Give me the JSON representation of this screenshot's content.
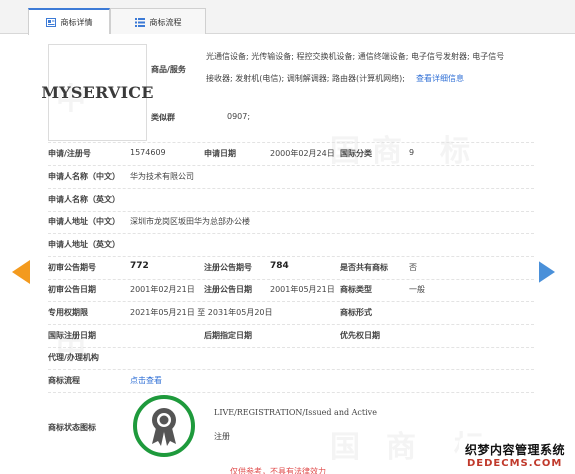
{
  "tabs": [
    {
      "label": "商标详情",
      "active": true
    },
    {
      "label": "商标流程",
      "active": false
    }
  ],
  "watermark_chars": [
    "中",
    "国",
    "商",
    "标"
  ],
  "logo_text": "MYSERVICE",
  "goods_services": {
    "label": "商品/服务",
    "line1": "光通信设备; 光传输设备; 程控交换机设备; 通信终端设备; 电子信号发射器; 电子信号",
    "line2": "接收器; 发射机(电信); 调制解调器; 路由器(计算机网络);",
    "more_link": "查看详细信息"
  },
  "similar_group": {
    "label": "类似群",
    "value": "0907;"
  },
  "fields": {
    "app_no_label": "申请/注册号",
    "app_no": "1574609",
    "app_date_label": "申请日期",
    "app_date": "2000年02月24日",
    "intl_class_label": "国际分类",
    "intl_class": "9",
    "applicant_cn_label": "申请人名称（中文）",
    "applicant_cn": "华为技术有限公司",
    "applicant_en_label": "申请人名称（英文）",
    "address_cn_label": "申请人地址（中文）",
    "address_cn": "深圳市龙岗区坂田华为总部办公楼",
    "address_en_label": "申请人地址（英文）",
    "prelim_issue_label": "初审公告期号",
    "prelim_issue": "772",
    "reg_issue_label": "注册公告期号",
    "reg_issue": "784",
    "shared_label": "是否共有商标",
    "shared": "否",
    "prelim_date_label": "初审公告日期",
    "prelim_date": "2001年02月21日",
    "reg_date_label": "注册公告日期",
    "reg_date": "2001年05月21日",
    "tm_type_label": "商标类型",
    "tm_type": "一般",
    "exclusive_label": "专用权期限",
    "exclusive": "2021年05月21日 至 2031年05月20日",
    "tm_form_label": "商标形式",
    "intl_reg_date_label": "国际注册日期",
    "later_date_label": "后期指定日期",
    "priority_date_label": "优先权日期",
    "agent_label": "代理/办理机构",
    "flow_label": "商标流程",
    "flow_link": "点击查看",
    "status_icon_label": "商标状态图标",
    "status_en": "LIVE/REGISTRATION/Issued and Active",
    "status_cn": "注册"
  },
  "footer_note": "仅供参考，不具有法律效力",
  "corner_badge": {
    "line1": "织梦内容管理系统",
    "line2": "DEDECMS.COM"
  },
  "colors": {
    "accent": "#3c7ad6",
    "arrow_left": "#f39a1e",
    "arrow_right": "#4a90d9",
    "badge_ring": "#1e9a3c"
  }
}
